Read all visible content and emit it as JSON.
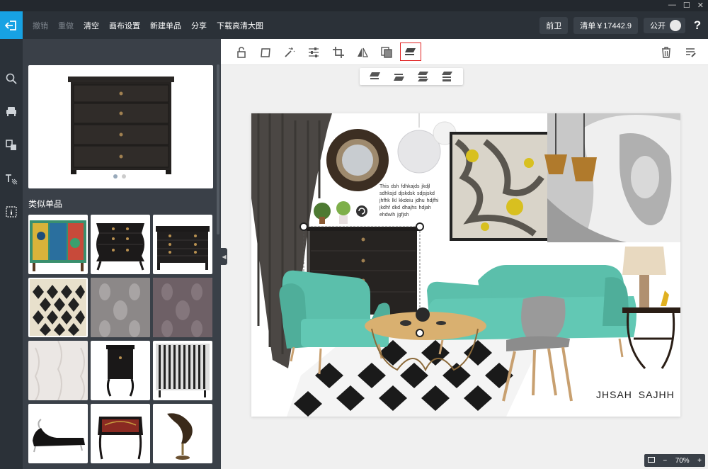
{
  "window": {
    "minimize": "—",
    "maximize": "☐",
    "close": "✕"
  },
  "menu": {
    "undo": "撤销",
    "redo": "重做",
    "clear": "清空",
    "canvas_settings": "画布设置",
    "new_item": "新建单品",
    "share": "分享",
    "download": "下载高清大图"
  },
  "header": {
    "style_tag": "前卫",
    "list_label": "清单￥17442.9",
    "public_label": "公开",
    "help": "?"
  },
  "sidebar": {
    "similar_title": "类似单品",
    "featured_item": "black-chest-of-drawers",
    "carousel_index": 1,
    "carousel_count": 2,
    "tiles": [
      "painted-cabinet",
      "black-bombe-chest",
      "black-ornate-dresser",
      "diamond-pattern-rug",
      "gray-damask-rug",
      "purple-damask-rug",
      "white-damask-wallpaper",
      "black-nightstand",
      "striped-cabinet",
      "black-chaise-lounge",
      "ornate-black-desk",
      "horn-sculpture"
    ]
  },
  "canvas": {
    "body_text": "This dsh  fdhkajds  jkdjl sdhksjd  djskdsk sdjsjskd jhfhk lkl kkdeiu jdhu  hdjfhi  jkdhf dkd  dhajhs  hdjah  ehdwih jgfjsh",
    "signature": "JHSAH  SAJHH"
  },
  "zoom": {
    "minus": "−",
    "level": "70%",
    "plus": "+"
  },
  "colors": {
    "accent": "#17a2e3",
    "topbar": "#2b3138",
    "sidebar": "#3a4048",
    "highlight": "#e02020",
    "teal": "#5bbfab"
  }
}
